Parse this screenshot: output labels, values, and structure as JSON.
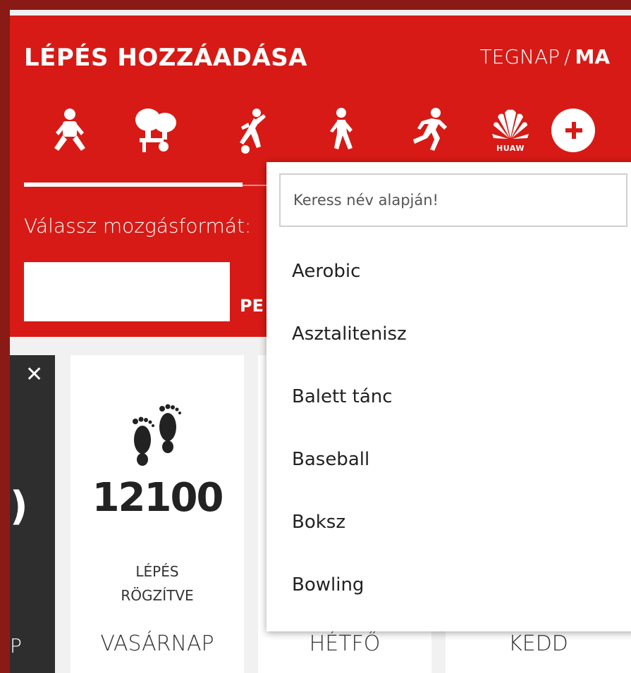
{
  "header": {
    "title": "LÉPÉS HOZZÁADÁSA",
    "day_selector": {
      "yesterday": "TEGNAP",
      "separator": "/",
      "today": "MA",
      "active": "MA"
    },
    "sport_icons": [
      "standing-exercise-icon",
      "table-tennis-icon",
      "football-icon",
      "walking-icon",
      "running-icon",
      "huawei-logo-icon",
      "add-icon"
    ],
    "huawei_label": "HUAW",
    "prompt": "Válassz mozgásformát:",
    "partial_button": "PE"
  },
  "dropdown": {
    "search_placeholder": "Keress név alapján!",
    "options": [
      "Aerobic",
      "Asztalitenisz",
      "Balett tánc",
      "Baseball",
      "Boksz",
      "Bowling"
    ]
  },
  "cards": {
    "dark_partial": {
      "close": "✕",
      "number_fragment": ")",
      "day_fragment": "P"
    },
    "sunday": {
      "steps": "12100",
      "label_line1": "LÉPÉS",
      "label_line2": "RÖGZÍTVE",
      "day": "VASÁRNAP"
    },
    "monday": {
      "day": "HÉTFŐ"
    },
    "tuesday": {
      "day": "KEDD"
    }
  },
  "colors": {
    "brand_red": "#d71a15",
    "background": "#8a1a16",
    "card_dark": "#2e2e2e"
  }
}
